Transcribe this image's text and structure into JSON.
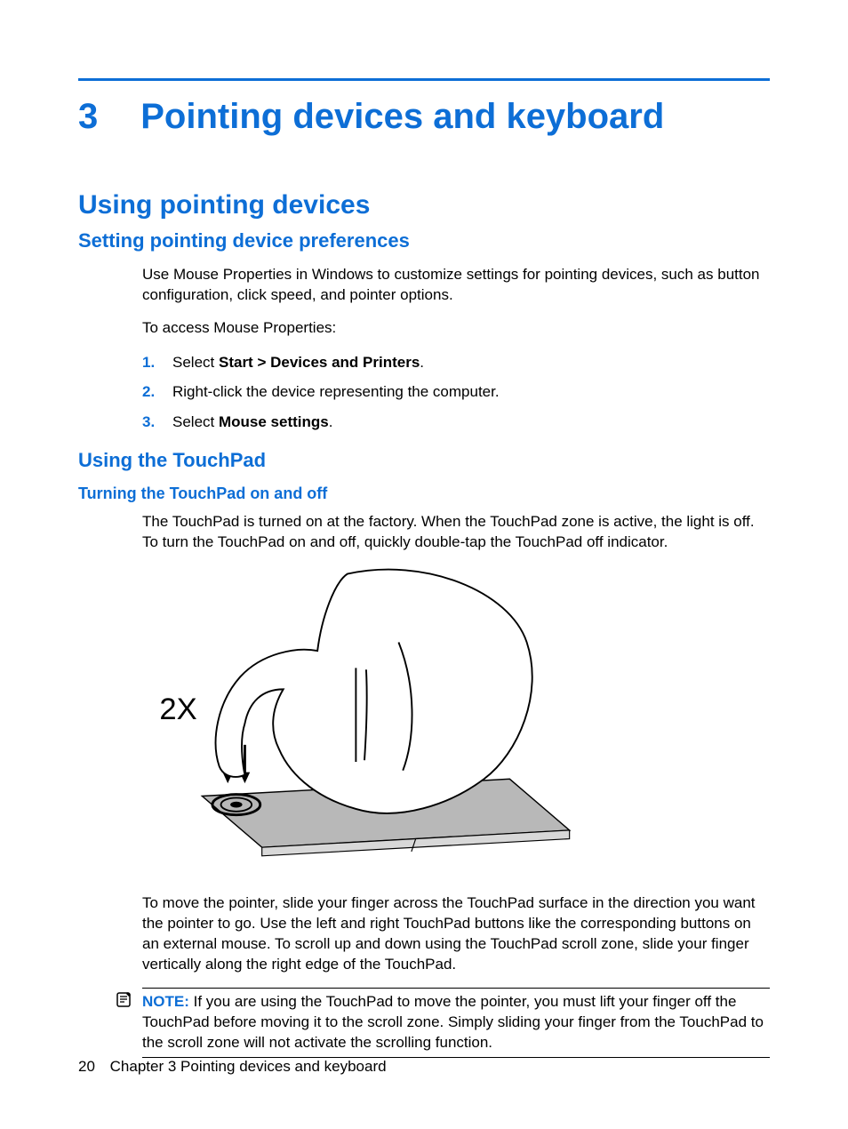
{
  "chapter": {
    "number": "3",
    "title": "Pointing devices and keyboard"
  },
  "h1": "Using pointing devices",
  "sectionA": {
    "heading": "Setting pointing device preferences",
    "p1": "Use Mouse Properties in Windows to customize settings for pointing devices, such as button configuration, click speed, and pointer options.",
    "p2": "To access Mouse Properties:",
    "steps": {
      "n1": "1.",
      "t1a": "Select ",
      "t1b": "Start > Devices and Printers",
      "t1c": ".",
      "n2": "2.",
      "t2": "Right-click the device representing the computer.",
      "n3": "3.",
      "t3a": "Select ",
      "t3b": "Mouse settings",
      "t3c": "."
    }
  },
  "sectionB": {
    "heading": "Using the TouchPad",
    "sub1": {
      "heading": "Turning the TouchPad on and off",
      "p1": "The TouchPad is turned on at the factory. When the TouchPad zone is active, the light is off. To turn the TouchPad on and off, quickly double-tap the TouchPad off indicator.",
      "figure_label": "2X",
      "p2": "To move the pointer, slide your finger across the TouchPad surface in the direction you want the pointer to go. Use the left and right TouchPad buttons like the corresponding buttons on an external mouse. To scroll up and down using the TouchPad scroll zone, slide your finger vertically along the right edge of the TouchPad.",
      "note_label": "NOTE:",
      "note_text": "If you are using the TouchPad to move the pointer, you must lift your finger off the TouchPad before moving it to the scroll zone. Simply sliding your finger from the TouchPad to the scroll zone will not activate the scrolling function."
    }
  },
  "footer": {
    "page": "20",
    "label": "Chapter 3   Pointing devices and keyboard"
  }
}
